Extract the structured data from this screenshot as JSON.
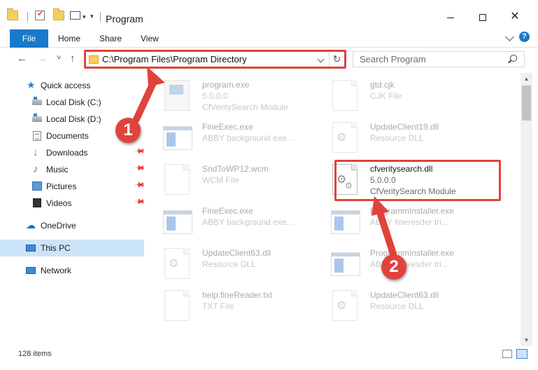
{
  "window": {
    "title": "Program",
    "minimize_glyph": "",
    "maximize_glyph": "",
    "close_glyph": "✕"
  },
  "ribbon": {
    "tabs": [
      "File",
      "Home",
      "Share",
      "View"
    ],
    "help_glyph": "?"
  },
  "nav": {
    "back_glyph": "←",
    "forward_glyph": "→",
    "recent_glyph": "˅",
    "up_glyph": "↑"
  },
  "address": {
    "path": "C:\\Program Files\\Program Directory",
    "refresh_glyph": "↻"
  },
  "search": {
    "placeholder": "Search Program"
  },
  "sidebar": {
    "items": [
      {
        "label": "Quick access",
        "icon": "star-icon"
      },
      {
        "label": "Local Disk (C:)",
        "icon": "drive-icon"
      },
      {
        "label": "Local Disk (D:)",
        "icon": "drive-icon"
      },
      {
        "label": "Documents",
        "icon": "documents-icon"
      },
      {
        "label": "Downloads",
        "icon": "download-icon",
        "pinned": true
      },
      {
        "label": "Music",
        "icon": "music-icon",
        "pinned": true
      },
      {
        "label": "Pictures",
        "icon": "pictures-icon",
        "pinned": true
      },
      {
        "label": "Videos",
        "icon": "videos-icon",
        "pinned": true
      },
      {
        "label": "OneDrive",
        "icon": "onedrive-icon"
      },
      {
        "label": "This PC",
        "icon": "computer-icon",
        "selected": true
      },
      {
        "label": "Network",
        "icon": "network-icon"
      }
    ]
  },
  "files": [
    {
      "name": "program.exe",
      "line2": "5.0.0.0",
      "line3": "CfVeritySearch Module",
      "icon": "app-icon",
      "faded": true
    },
    {
      "name": "gtd.cjk",
      "line2": "CJK File",
      "line3": "",
      "icon": "file-icon",
      "faded": true
    },
    {
      "name": "FineExec.exe",
      "line2": "ABBY background exe...",
      "line3": "",
      "icon": "exe-window-icon",
      "faded": true
    },
    {
      "name": "UpdateClient19.dll",
      "line2": "Resource DLL",
      "line3": "",
      "icon": "dll-icon",
      "faded": true
    },
    {
      "name": "SndToWP12.wcm",
      "line2": "WCM File",
      "line3": "",
      "icon": "file-icon",
      "faded": true
    },
    {
      "name": "cfveritysearch.dll",
      "line2": "5.0.0.0",
      "line3": "CfVeritySearch Module",
      "icon": "dll-icon",
      "faded": false
    },
    {
      "name": "FineExec.exe",
      "line2": "ABBY background exe...",
      "line3": "",
      "icon": "exe-window-icon",
      "faded": true
    },
    {
      "name": "ProgrammInstaller.exe",
      "line2": "ABBY fineresder tri...",
      "line3": "",
      "icon": "exe-window-icon",
      "faded": true
    },
    {
      "name": "UpdateClient63.dll",
      "line2": "Resource DLL",
      "line3": "",
      "icon": "dll-icon",
      "faded": true
    },
    {
      "name": "ProgrammInstaller.exe",
      "line2": "ABBY fineresder tri...",
      "line3": "",
      "icon": "exe-window-icon",
      "faded": true
    },
    {
      "name": "help.fineReader.txt",
      "line2": "TXT File",
      "line3": "",
      "icon": "file-icon",
      "faded": true
    },
    {
      "name": "UpdateClient63.dll",
      "line2": "Resource DLL",
      "line3": "",
      "icon": "dll-icon",
      "faded": true
    }
  ],
  "status": {
    "item_count": "128 items"
  },
  "annotations": {
    "marker1": "1",
    "marker2": "2",
    "color": "#e0433b"
  },
  "colors": {
    "accent": "#1979ca",
    "selection": "#cce4f7",
    "highlight": "#e0433b"
  }
}
